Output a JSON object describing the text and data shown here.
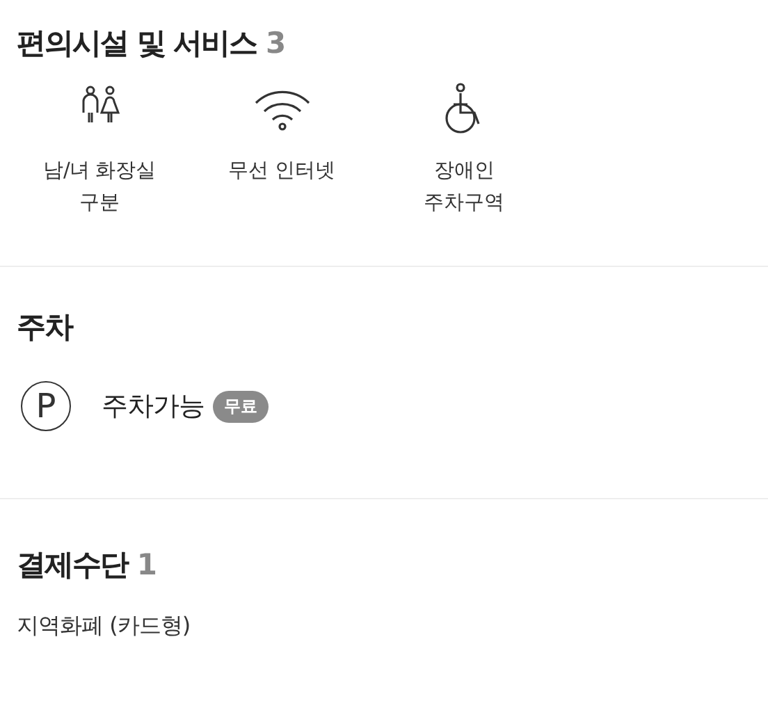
{
  "facilities": {
    "title": "편의시설 및 서비스",
    "count": "3",
    "items": [
      {
        "kind": "restroom",
        "label": "남/녀 화장실\n구분"
      },
      {
        "kind": "wifi",
        "label": "무선 인터넷"
      },
      {
        "kind": "accessible-parking",
        "label": "장애인\n주차구역"
      }
    ]
  },
  "parking": {
    "title": "주차",
    "icon_letter": "P",
    "label": "주차가능",
    "badge": "무료"
  },
  "payment": {
    "title": "결제수단",
    "count": "1",
    "items": [
      "지역화폐 (카드형)"
    ]
  }
}
